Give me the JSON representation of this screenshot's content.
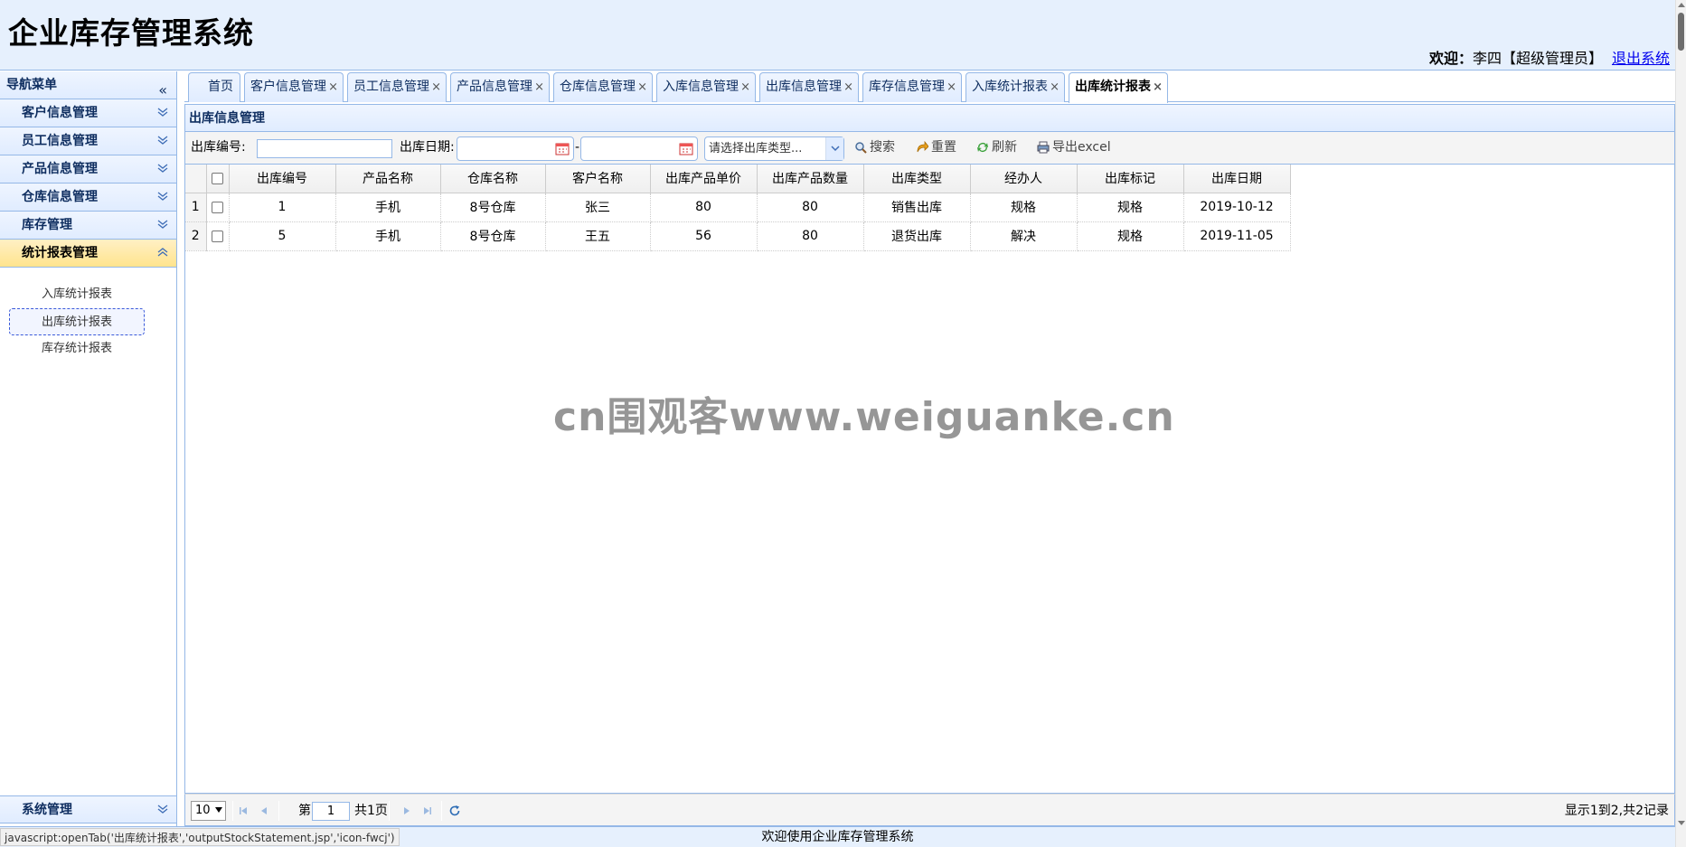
{
  "app": {
    "title": "企业库存管理系统",
    "welcome_label": "欢迎：",
    "user": "李四【超级管理员】",
    "logout": "退出系统"
  },
  "sidebar": {
    "title": "导航菜单",
    "collapse_icon": "double-chevron-left-icon",
    "sections": [
      {
        "label": "客户信息管理",
        "expanded": false
      },
      {
        "label": "员工信息管理",
        "expanded": false
      },
      {
        "label": "产品信息管理",
        "expanded": false
      },
      {
        "label": "仓库信息管理",
        "expanded": false
      },
      {
        "label": "库存管理",
        "expanded": false
      },
      {
        "label": "统计报表管理",
        "expanded": true
      }
    ],
    "report_items": [
      "入库统计报表",
      "出库统计报表",
      "库存统计报表"
    ],
    "selected_item": "出库统计报表",
    "bottom_section": "系统管理"
  },
  "tabs": [
    {
      "label": "首页",
      "closable": false
    },
    {
      "label": "客户信息管理",
      "closable": true
    },
    {
      "label": "员工信息管理",
      "closable": true
    },
    {
      "label": "产品信息管理",
      "closable": true
    },
    {
      "label": "仓库信息管理",
      "closable": true
    },
    {
      "label": "入库信息管理",
      "closable": true
    },
    {
      "label": "出库信息管理",
      "closable": true
    },
    {
      "label": "库存信息管理",
      "closable": true
    },
    {
      "label": "入库统计报表",
      "closable": true
    },
    {
      "label": "出库统计报表",
      "closable": true,
      "active": true
    }
  ],
  "tab_close_glyph": "×",
  "panel": {
    "title": "出库信息管理"
  },
  "toolbar": {
    "id_label": "出库编号:",
    "id_value": "",
    "date_label": "出库日期:",
    "date_from": "",
    "date_sep": "-",
    "date_to": "",
    "type_placeholder": "请选择出库类型...",
    "search": "搜索",
    "reset": "重置",
    "refresh": "刷新",
    "export": "导出excel"
  },
  "grid": {
    "columns": [
      "出库编号",
      "产品名称",
      "仓库名称",
      "客户名称",
      "出库产品单价",
      "出库产品数量",
      "出库类型",
      "经办人",
      "出库标记",
      "出库日期"
    ],
    "rows": [
      {
        "rn": "1",
        "cells": [
          "1",
          "手机",
          "8号仓库",
          "张三",
          "80",
          "80",
          "销售出库",
          "规格",
          "规格",
          "2019-10-12"
        ]
      },
      {
        "rn": "2",
        "cells": [
          "5",
          "手机",
          "8号仓库",
          "王五",
          "56",
          "80",
          "退货出库",
          "解决",
          "规格",
          "2019-11-05"
        ]
      }
    ]
  },
  "pager": {
    "page_size": "10",
    "page_prefix": "第",
    "page": "1",
    "page_suffix": "共1页",
    "info": "显示1到2,共2记录"
  },
  "status": {
    "url": "javascript:openTab('出库统计报表','outputStockStatement.jsp','icon-fwcj')",
    "footer": "欢迎使用企业库存管理系统"
  },
  "watermark": "cn围观客www.weiguanke.cn",
  "colors": {
    "header_bg": "#e6f0fd",
    "border": "#95b8e7",
    "active_section": "#ffe48d",
    "accent_text": "#0e2d5f"
  }
}
